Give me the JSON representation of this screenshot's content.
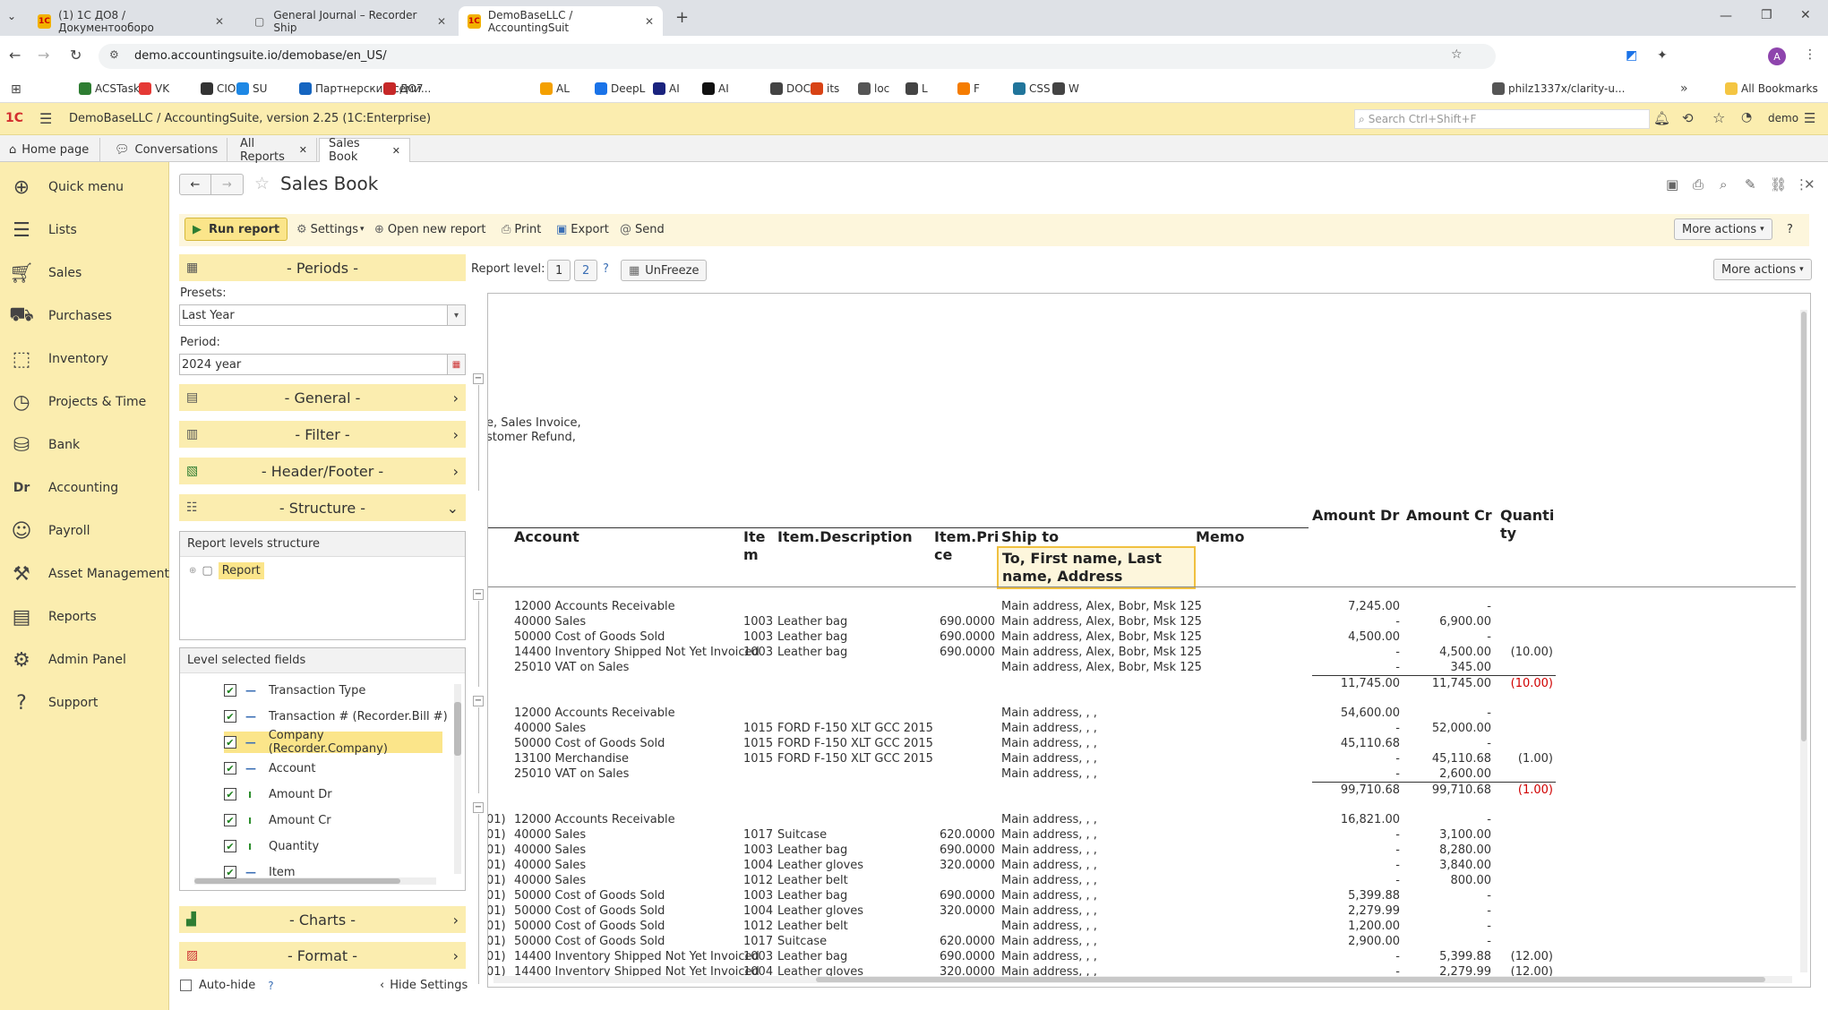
{
  "browser": {
    "tabs": [
      {
        "label": "(1) 1С ДО8 / Документооборо",
        "active": false
      },
      {
        "label": "General Journal – Recorder Ship",
        "active": false
      },
      {
        "label": "DemoBaseLLC / AccountingSuit",
        "active": true
      }
    ],
    "url": "demo.accountingsuite.io/demobase/en_US/",
    "profile_letter": "A",
    "bookmarks": [
      "ACSTask",
      "VK",
      "CIO",
      "SU",
      "Партнерский семи...",
      "ДО7",
      "AL",
      "DeepL",
      "AI",
      "AI",
      "DOC",
      "its",
      "loc",
      "L",
      "F",
      "CSS",
      "W",
      "philz1337x/clarity-u..."
    ],
    "all_bookmarks": "All Bookmarks"
  },
  "app": {
    "title": "DemoBaseLLC / AccountingSuite, version 2.25  (1C:Enterprise)",
    "search_placeholder": "Search Ctrl+Shift+F",
    "user": "demo",
    "tabs": [
      "Home page",
      "Conversations",
      "All Reports",
      "Sales Book"
    ]
  },
  "sidebar": {
    "items": [
      "Quick menu",
      "Lists",
      "Sales",
      "Purchases",
      "Inventory",
      "Projects & Time",
      "Bank",
      "Accounting",
      "Payroll",
      "Asset Management",
      "Reports",
      "Admin Panel",
      "Support"
    ]
  },
  "form": {
    "title": "Sales Book",
    "toolbar": {
      "run": "Run report",
      "settings": "Settings",
      "open_new": "Open new report",
      "print": "Print",
      "export": "Export",
      "send": "Send",
      "more_actions": "More actions",
      "help": "?"
    }
  },
  "settings": {
    "periods": "- Periods -",
    "presets_label": "Presets:",
    "presets_value": "Last Year",
    "period_label": "Period:",
    "period_value": "2024 year",
    "general": "- General -",
    "filter": "- Filter -",
    "header_footer": "- Header/Footer -",
    "structure": "- Structure -",
    "report_levels_structure": "Report levels structure",
    "report_node": "Report",
    "level_selected_fields": "Level selected fields",
    "fields": [
      "Transaction Type",
      "Transaction # (Recorder.Bill #)",
      "Company (Recorder.Company)",
      "Account",
      "Amount Dr",
      "Amount Cr",
      "Quantity",
      "Item"
    ],
    "charts": "- Charts -",
    "format": "- Format -",
    "auto_hide": "Auto-hide",
    "hide_settings": "Hide Settings"
  },
  "report_bar": {
    "level_label": "Report level:",
    "level1": "1",
    "level2": "2",
    "help": "?",
    "unfreeze": "UnFreeze",
    "more_actions": "More actions"
  },
  "report": {
    "header_note": [
      "e, Sales Invoice,",
      "stomer Refund,"
    ],
    "columns": {
      "account": "Account",
      "item": "Ite m",
      "item_desc": "Item.Description",
      "item_price": "Item.Pri ce",
      "ship_to": "Ship to",
      "ship_to_sub": "To, First name, Last name, Address",
      "memo": "Memo",
      "amount_dr": "Amount Dr",
      "amount_cr": "Amount Cr",
      "quantity": "Quanti ty"
    },
    "groups": [
      {
        "rows": [
          {
            "pre": "",
            "account": "12000 Accounts Receivable",
            "item": "",
            "desc": "",
            "price": "",
            "ship": "Main address, Alex, Bobr, Msk 125",
            "dr": "7,245.00",
            "cr": "-",
            "qty": ""
          },
          {
            "pre": "",
            "account": "40000 Sales",
            "item": "1003",
            "desc": "Leather bag",
            "price": "690.0000",
            "ship": "Main address, Alex, Bobr, Msk 125",
            "dr": "-",
            "cr": "6,900.00",
            "qty": ""
          },
          {
            "pre": "",
            "account": "50000 Cost of Goods Sold",
            "item": "1003",
            "desc": "Leather bag",
            "price": "690.0000",
            "ship": "Main address, Alex, Bobr, Msk 125",
            "dr": "4,500.00",
            "cr": "-",
            "qty": ""
          },
          {
            "pre": "",
            "account": "14400 Inventory Shipped Not Yet Invoiced",
            "item": "1003",
            "desc": "Leather bag",
            "price": "690.0000",
            "ship": "Main address, Alex, Bobr, Msk 125",
            "dr": "-",
            "cr": "4,500.00",
            "qty": "(10.00)"
          },
          {
            "pre": "",
            "account": "25010 VAT on Sales",
            "item": "",
            "desc": "",
            "price": "",
            "ship": "Main address, Alex, Bobr, Msk 125",
            "dr": "-",
            "cr": "345.00",
            "qty": ""
          }
        ],
        "total": {
          "dr": "11,745.00",
          "cr": "11,745.00",
          "qty": "(10.00)"
        }
      },
      {
        "rows": [
          {
            "pre": "",
            "account": "12000 Accounts Receivable",
            "item": "",
            "desc": "",
            "price": "",
            "ship": "Main address, , ,",
            "dr": "54,600.00",
            "cr": "-",
            "qty": ""
          },
          {
            "pre": "",
            "account": "40000 Sales",
            "item": "1015",
            "desc": "FORD F-150 XLT GCC 2015",
            "price": "",
            "ship": "Main address, , ,",
            "dr": "-",
            "cr": "52,000.00",
            "qty": ""
          },
          {
            "pre": "",
            "account": "50000 Cost of Goods Sold",
            "item": "1015",
            "desc": "FORD F-150 XLT GCC 2015",
            "price": "",
            "ship": "Main address, , ,",
            "dr": "45,110.68",
            "cr": "-",
            "qty": ""
          },
          {
            "pre": "",
            "account": "13100 Merchandise",
            "item": "1015",
            "desc": "FORD F-150 XLT GCC 2015",
            "price": "",
            "ship": "Main address, , ,",
            "dr": "-",
            "cr": "45,110.68",
            "qty": "(1.00)"
          },
          {
            "pre": "",
            "account": "25010 VAT on Sales",
            "item": "",
            "desc": "",
            "price": "",
            "ship": "Main address, , ,",
            "dr": "-",
            "cr": "2,600.00",
            "qty": ""
          }
        ],
        "total": {
          "dr": "99,710.68",
          "cr": "99,710.68",
          "qty": "(1.00)"
        }
      },
      {
        "rows": [
          {
            "pre": "01)",
            "account": "12000 Accounts Receivable",
            "item": "",
            "desc": "",
            "price": "",
            "ship": "Main address, , ,",
            "dr": "16,821.00",
            "cr": "-",
            "qty": ""
          },
          {
            "pre": "01)",
            "account": "40000 Sales",
            "item": "1017",
            "desc": "Suitcase",
            "price": "620.0000",
            "ship": "Main address, , ,",
            "dr": "-",
            "cr": "3,100.00",
            "qty": ""
          },
          {
            "pre": "01)",
            "account": "40000 Sales",
            "item": "1003",
            "desc": "Leather bag",
            "price": "690.0000",
            "ship": "Main address, , ,",
            "dr": "-",
            "cr": "8,280.00",
            "qty": ""
          },
          {
            "pre": "01)",
            "account": "40000 Sales",
            "item": "1004",
            "desc": "Leather gloves",
            "price": "320.0000",
            "ship": "Main address, , ,",
            "dr": "-",
            "cr": "3,840.00",
            "qty": ""
          },
          {
            "pre": "01)",
            "account": "40000 Sales",
            "item": "1012",
            "desc": "Leather belt",
            "price": "",
            "ship": "Main address, , ,",
            "dr": "-",
            "cr": "800.00",
            "qty": ""
          },
          {
            "pre": "01)",
            "account": "50000 Cost of Goods Sold",
            "item": "1003",
            "desc": "Leather bag",
            "price": "690.0000",
            "ship": "Main address, , ,",
            "dr": "5,399.88",
            "cr": "-",
            "qty": ""
          },
          {
            "pre": "01)",
            "account": "50000 Cost of Goods Sold",
            "item": "1004",
            "desc": "Leather gloves",
            "price": "320.0000",
            "ship": "Main address, , ,",
            "dr": "2,279.99",
            "cr": "-",
            "qty": ""
          },
          {
            "pre": "01)",
            "account": "50000 Cost of Goods Sold",
            "item": "1012",
            "desc": "Leather belt",
            "price": "",
            "ship": "Main address, , ,",
            "dr": "1,200.00",
            "cr": "-",
            "qty": ""
          },
          {
            "pre": "01)",
            "account": "50000 Cost of Goods Sold",
            "item": "1017",
            "desc": "Suitcase",
            "price": "620.0000",
            "ship": "Main address, , ,",
            "dr": "2,900.00",
            "cr": "-",
            "qty": ""
          },
          {
            "pre": "01)",
            "account": "14400 Inventory Shipped Not Yet Invoiced",
            "item": "1003",
            "desc": "Leather bag",
            "price": "690.0000",
            "ship": "Main address, , ,",
            "dr": "-",
            "cr": "5,399.88",
            "qty": "(12.00)"
          },
          {
            "pre": "01)",
            "account": "14400 Inventory Shipped Not Yet Invoiced",
            "item": "1004",
            "desc": "Leather gloves",
            "price": "320.0000",
            "ship": "Main address, , ,",
            "dr": "-",
            "cr": "2,279.99",
            "qty": "(12.00)"
          }
        ]
      }
    ]
  }
}
